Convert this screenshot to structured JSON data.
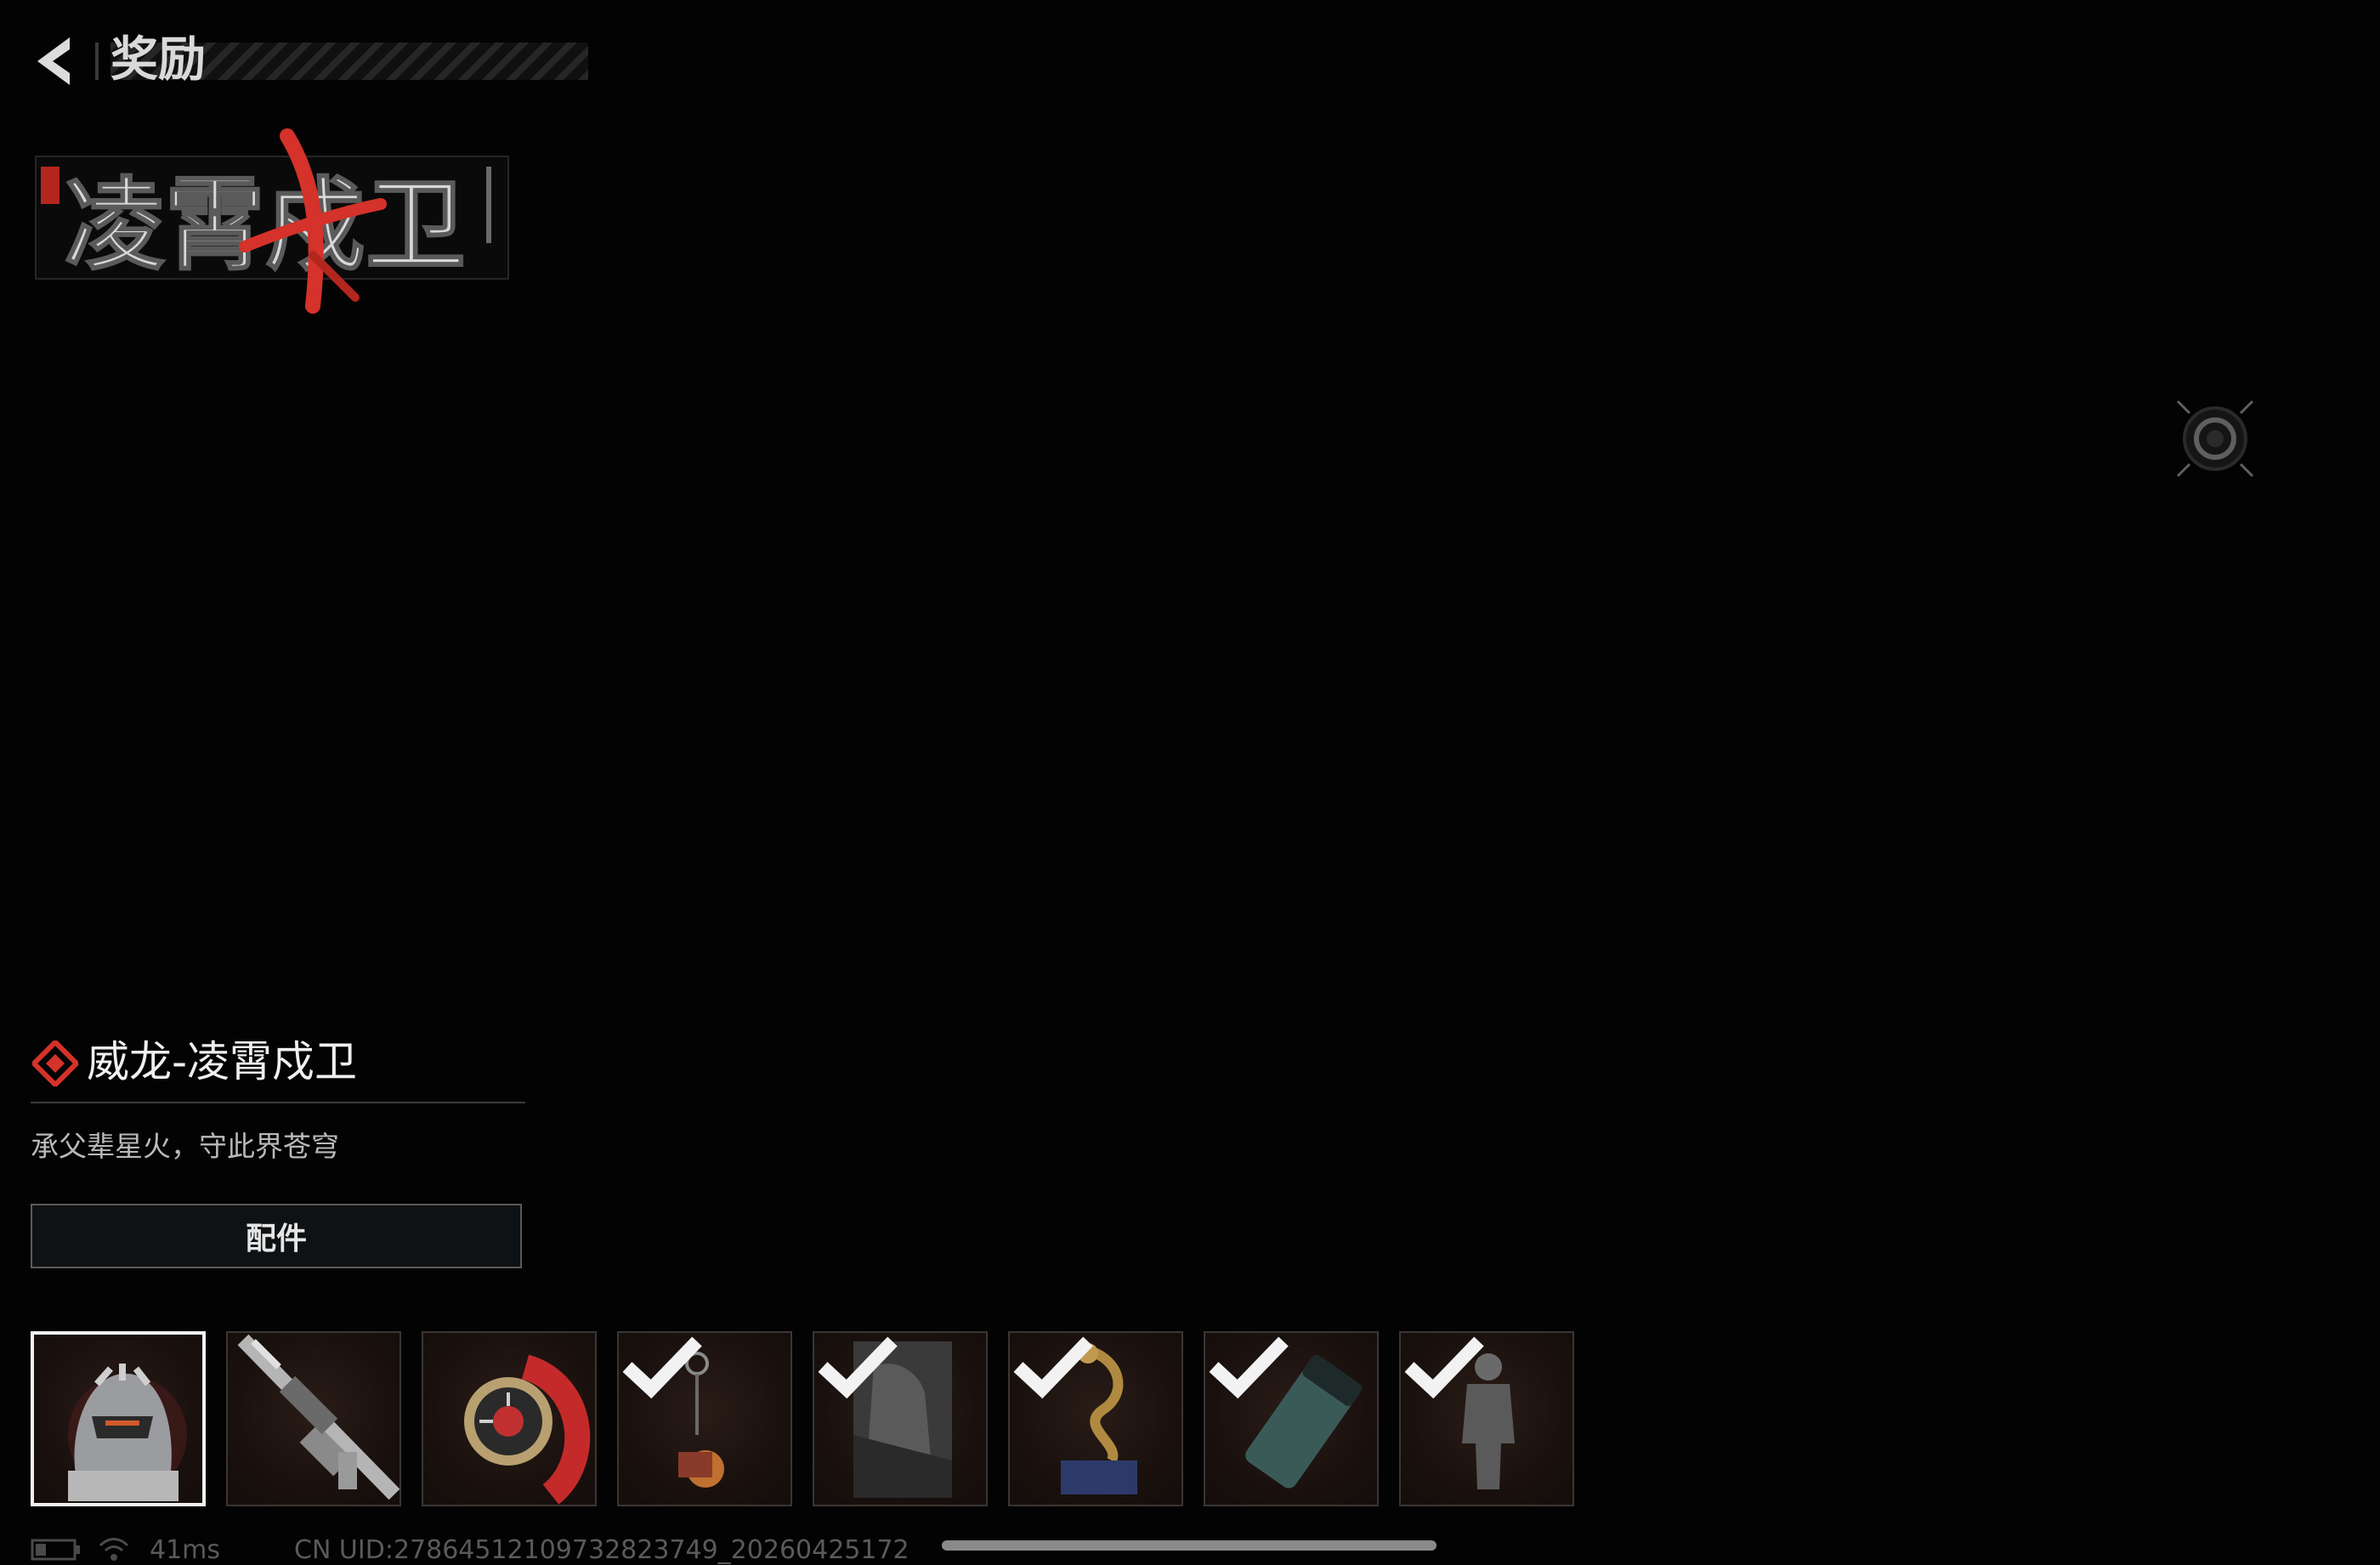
{
  "header": {
    "title": "奖励"
  },
  "logo": {
    "text": "凌霄戍卫"
  },
  "item": {
    "name": "威龙-凌霄戍卫",
    "description": "承父辈星火，守此界苍穹",
    "parts_button_label": "配件"
  },
  "rewards": [
    {
      "name": "operator-skin",
      "selected": true,
      "claimed": false
    },
    {
      "name": "rifle-skin",
      "selected": false,
      "claimed": false
    },
    {
      "name": "watch",
      "selected": false,
      "claimed": false
    },
    {
      "name": "charm",
      "selected": false,
      "claimed": true
    },
    {
      "name": "card",
      "selected": false,
      "claimed": true
    },
    {
      "name": "dragon-figure",
      "selected": false,
      "claimed": true
    },
    {
      "name": "spray",
      "selected": false,
      "claimed": true
    },
    {
      "name": "figure",
      "selected": false,
      "claimed": true
    }
  ],
  "status_bar": {
    "ping": "41ms",
    "uid": "CN UID:27864512109732823749_20260425172"
  },
  "colors": {
    "accent_red": "#d4322a",
    "background": "#030303"
  }
}
